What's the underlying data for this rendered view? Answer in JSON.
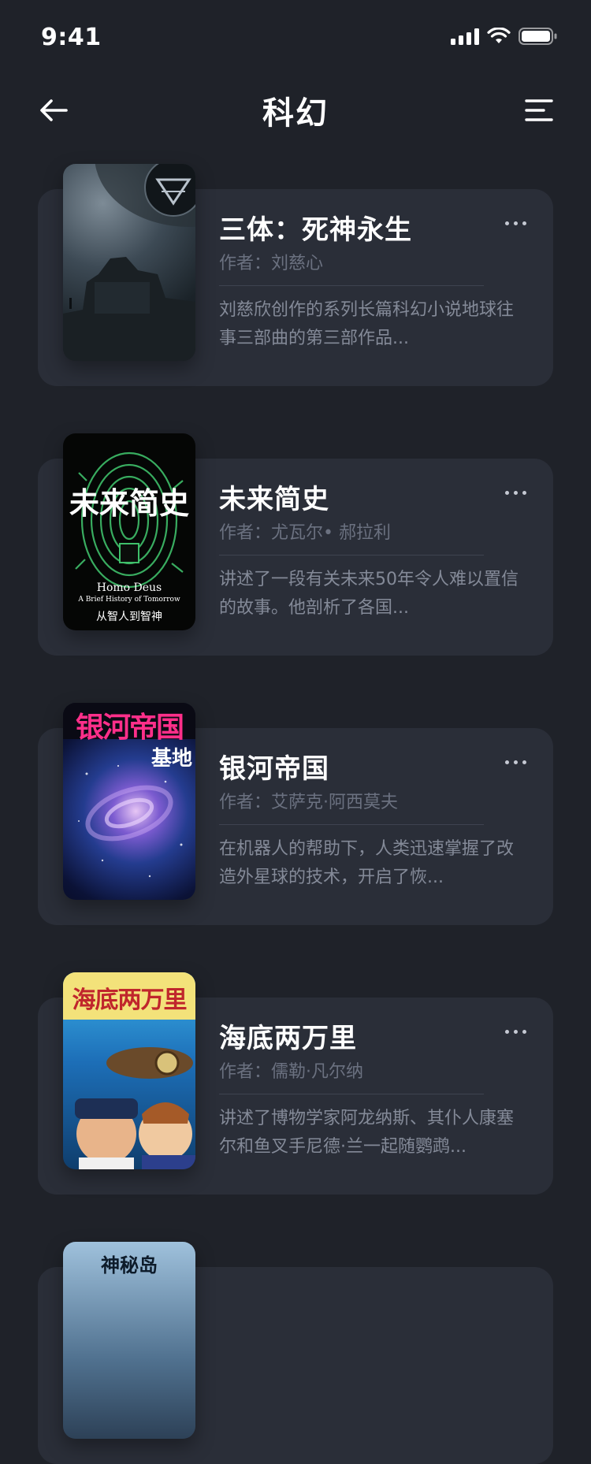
{
  "status_bar": {
    "time": "9:41"
  },
  "nav": {
    "title": "科幻",
    "back_icon": "arrow-left-icon",
    "menu_icon": "menu-icon"
  },
  "books": [
    {
      "title": "三体：死神永生",
      "author": "作者：刘慈心",
      "description": "刘慈欣创作的系列长篇科幻小说地球往事三部曲的第三部作品..."
    },
    {
      "title": "未来简史",
      "author": "作者：尤瓦尔• 郝拉利",
      "description": "讲述了一段有关未来50年令人难以置信的故事。他剖析了各国...",
      "cover_title": "未来简史",
      "cover_subtitle_en": "Homo Deus",
      "cover_subtitle_en2": "A Brief History of Tomorrow",
      "cover_subtitle_cn": "从智人到智神"
    },
    {
      "title": "银河帝国",
      "author": "作者：艾萨克·阿西莫夫",
      "description": "在机器人的帮助下，人类迅速掌握了改造外星球的技术，开启了恢...",
      "cover_title": "银河帝国",
      "cover_subtitle": "基地"
    },
    {
      "title": "海底两万里",
      "author": "作者：儒勒·凡尔纳",
      "description": "讲述了博物学家阿龙纳斯、其仆人康塞尔和鱼叉手尼德·兰一起随鹦鹉...",
      "cover_title": "海底两万里"
    },
    {
      "cover_title": "神秘岛"
    }
  ]
}
